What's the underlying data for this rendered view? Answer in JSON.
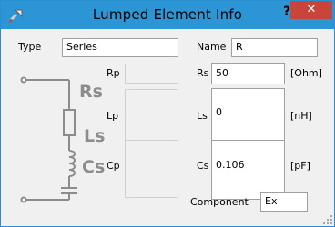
{
  "window": {
    "title": "Lumped Element Info",
    "help_label": "?",
    "close_label": "✕"
  },
  "type": {
    "label": "Type",
    "value": "Series"
  },
  "name": {
    "label": "Name",
    "value": "R"
  },
  "rp": {
    "label": "Rp",
    "value": ""
  },
  "lp": {
    "label": "Lp",
    "value": ""
  },
  "cp": {
    "label": "Cp",
    "value": ""
  },
  "rs": {
    "label": "Rs",
    "value": "50",
    "unit": "[Ohm]"
  },
  "ls": {
    "label": "Ls",
    "value": "0",
    "unit": "[nH]"
  },
  "cs": {
    "label": "Cs",
    "value": "0.106",
    "unit": "[pF]"
  },
  "component": {
    "label": "Component",
    "value": "Ex"
  },
  "diagram": {
    "rs_label": "Rs",
    "ls_label": "Ls",
    "cs_label": "Cs"
  },
  "colors": {
    "titlebar": "#2b95d6",
    "close": "#c9443a",
    "diagram": "#8c8c8c"
  }
}
